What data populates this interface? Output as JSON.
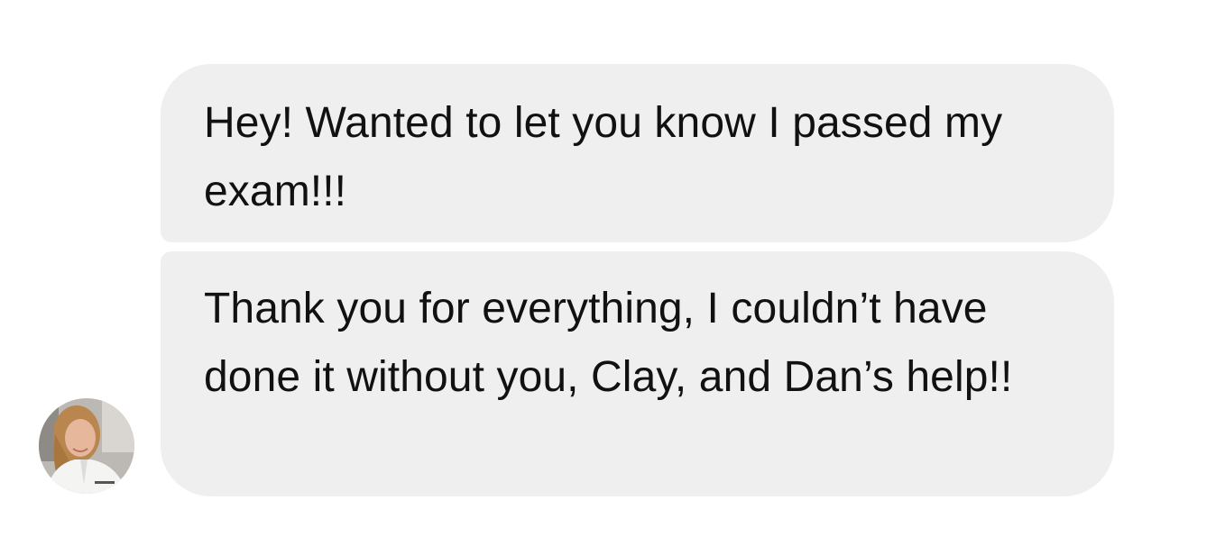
{
  "conversation": {
    "messages": [
      {
        "text": "Hey! Wanted to let you know I passed my exam!!!"
      },
      {
        "text": "Thank you for everything, I couldn’t have done it without you, Clay, and Dan’s help!!"
      }
    ],
    "avatar": {
      "icon": "user-photo-avatar"
    }
  },
  "colors": {
    "bubble_background": "#efefef",
    "text": "#111111",
    "page_background": "#ffffff"
  }
}
